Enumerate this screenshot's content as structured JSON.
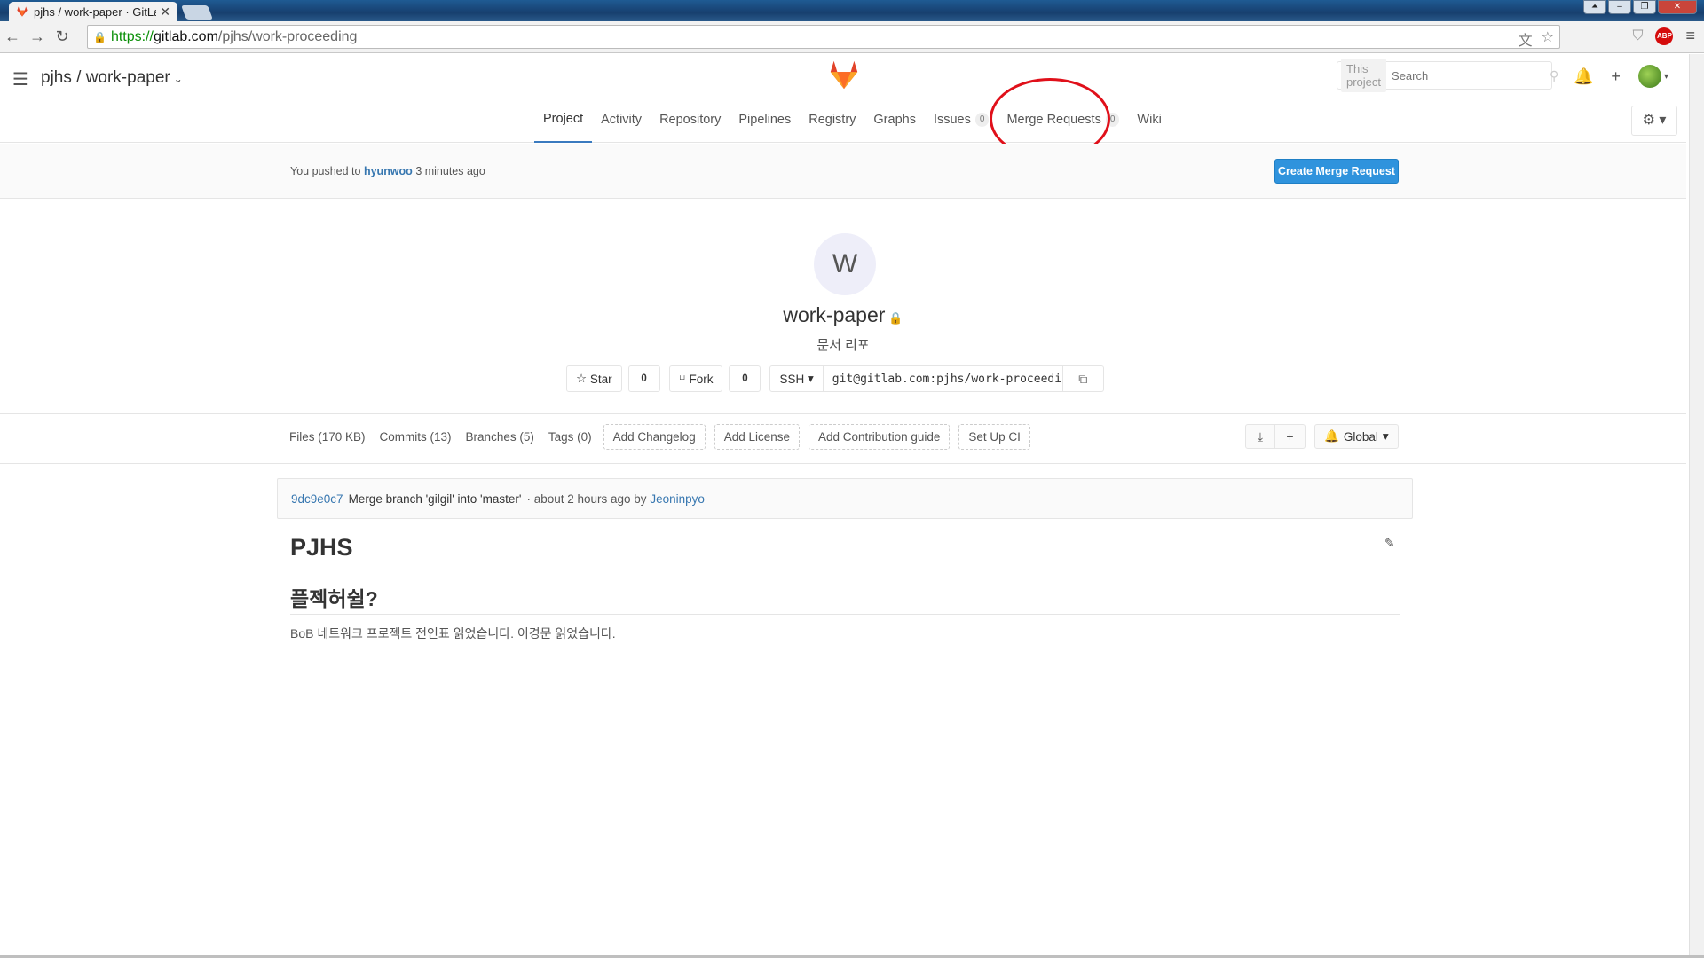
{
  "browser": {
    "tab_title": "pjhs / work-paper · GitLa",
    "tab_close": "✕",
    "url_secure": "https://",
    "url_host": "gitlab.com",
    "url_path": "/pjhs/work-proceeding",
    "window_controls": [
      "⏶",
      "–",
      "❐",
      "✕"
    ],
    "icons": [
      "translate-icon",
      "star-icon",
      "shield-icon",
      "adblock-icon",
      "menu-icon"
    ],
    "abp_label": "ABP"
  },
  "header": {
    "breadcrumb": "pjhs / work-paper",
    "search_scope": "This project",
    "search_placeholder": "Search",
    "nav": [
      {
        "label": "Project",
        "active": true
      },
      {
        "label": "Activity"
      },
      {
        "label": "Repository"
      },
      {
        "label": "Pipelines"
      },
      {
        "label": "Registry"
      },
      {
        "label": "Graphs"
      },
      {
        "label": "Issues",
        "badge": "0"
      },
      {
        "label": "Merge Requests",
        "badge": "0"
      },
      {
        "label": "Wiki"
      }
    ]
  },
  "push_alert": {
    "prefix": "You pushed to",
    "branch": "hyunwoo",
    "suffix": "3 minutes ago",
    "button": "Create Merge Request"
  },
  "project": {
    "avatar_letter": "W",
    "name": "work-paper",
    "description": "문서 리포",
    "star_label": "Star",
    "star_count": "0",
    "fork_label": "Fork",
    "fork_count": "0",
    "protocol": "SSH",
    "clone_url": "git@gitlab.com:pjhs/work-proceedi"
  },
  "stats": {
    "files": "Files (170 KB)",
    "commits": "Commits (13)",
    "branches": "Branches (5)",
    "tags": "Tags (0)",
    "add_changelog": "Add Changelog",
    "add_license": "Add License",
    "add_contribution": "Add Contribution guide",
    "setup_ci": "Set Up CI",
    "notification": "Global"
  },
  "commit": {
    "sha": "9dc9e0c7",
    "message": "Merge branch 'gilgil' into 'master'",
    "time": "· about 2 hours ago by",
    "author": "Jeoninpyo"
  },
  "readme": {
    "h1": "PJHS",
    "h2": "플젝허쉴?",
    "paragraph": "BoB 네트워크 프로젝트 전인표 읽었습니다. 이경문 읽었습니다."
  },
  "colors": {
    "accent": "#2f93dd",
    "link": "#3777b0",
    "annotation_circle": "#e0101a"
  }
}
